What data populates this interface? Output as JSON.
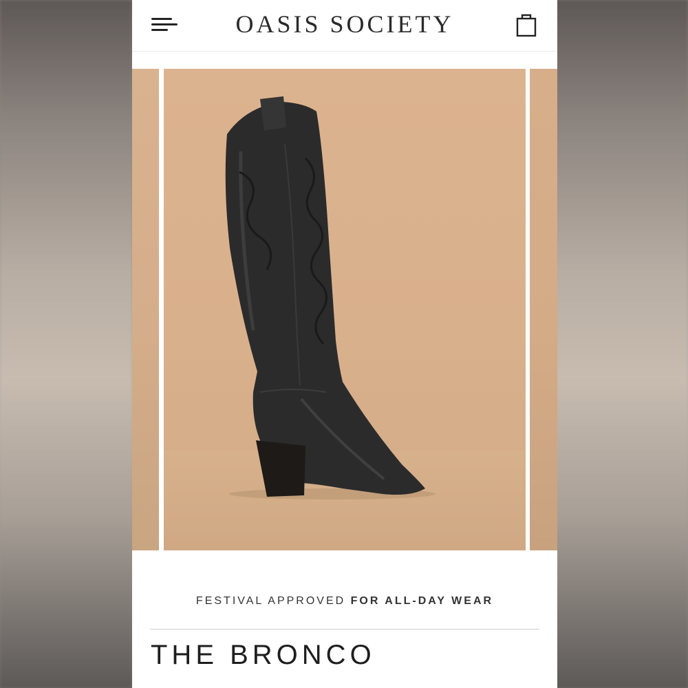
{
  "header": {
    "brand": "OASIS SOCIETY",
    "menu_icon": "hamburger-menu-icon",
    "cart_icon": "shopping-bag-icon"
  },
  "carousel": {
    "image_label": "black knee-high western boot"
  },
  "promo": {
    "tagline_regular": "FESTIVAL APPROVED",
    "tagline_bold": "FOR ALL-DAY WEAR"
  },
  "product": {
    "title": "THE BRONCO"
  },
  "colors": {
    "background": "#ffffff",
    "photo_backdrop": "#d9b08c",
    "text": "#2a2a2a"
  }
}
